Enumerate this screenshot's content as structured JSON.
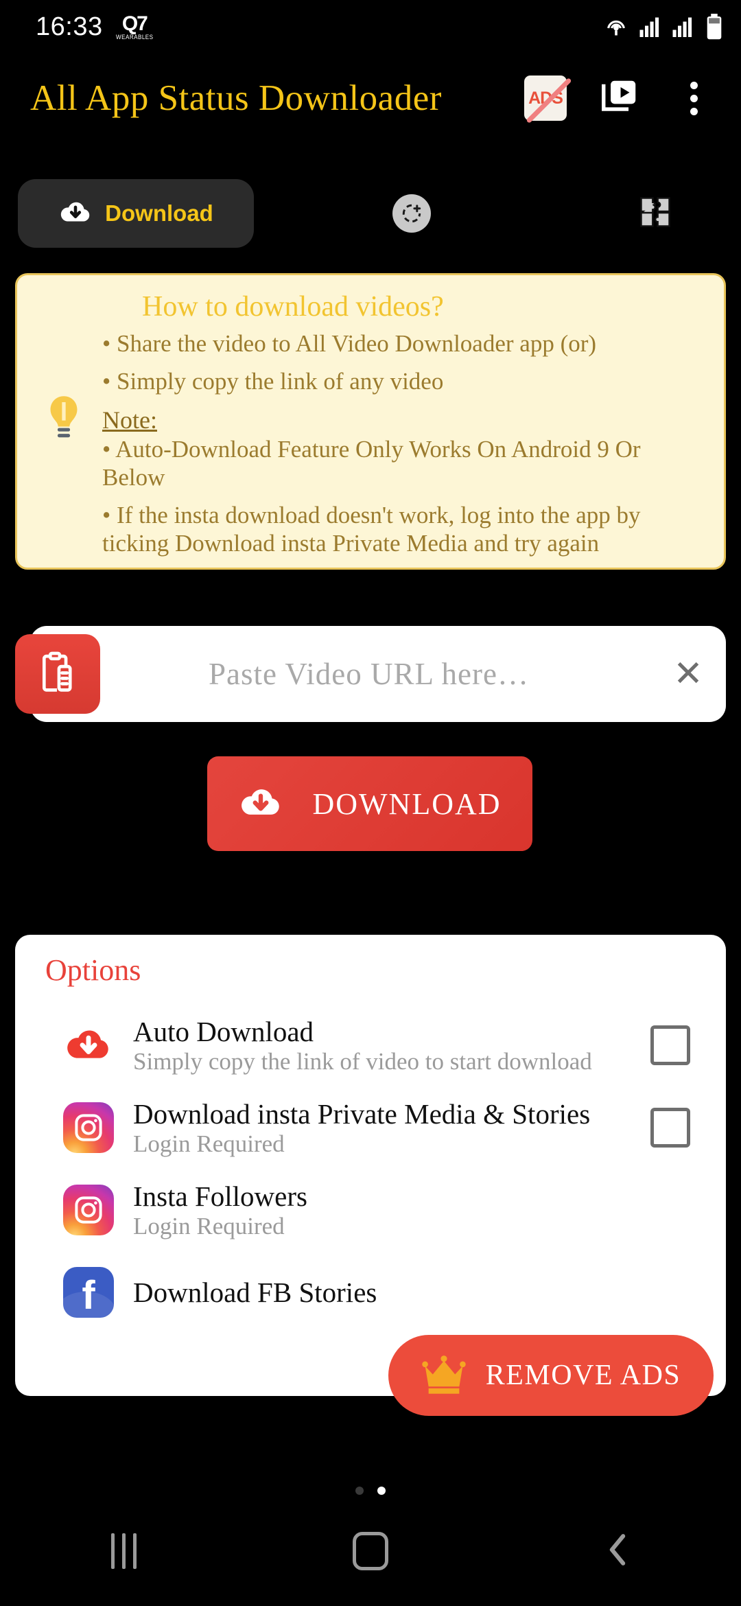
{
  "status_bar": {
    "time": "16:33",
    "app_badge_main": "Q7",
    "app_badge_sub": "WEARABLES",
    "icons": [
      "hotspot-icon",
      "signal-sim1-icon",
      "signal-sim2-icon",
      "battery-icon"
    ]
  },
  "app_bar": {
    "title": "All App Status Downloader",
    "title_color": "#F5C518",
    "no_ads_label": "ADS",
    "actions": [
      "no-ads-icon",
      "video-library-icon",
      "overflow-menu-icon"
    ]
  },
  "tabs": {
    "download_label": "Download",
    "download_icon": "cloud-download-icon",
    "status_icon": "add-status-icon",
    "puzzle_icon": "puzzle-icon",
    "active": "Download"
  },
  "info_card": {
    "icon": "lightbulb-icon",
    "title": "How to download videos?",
    "bullets": [
      "• Share the video to All Video Downloader app (or)",
      "• Simply copy the link of any video"
    ],
    "note_heading": "Note:",
    "notes": [
      "• Auto-Download Feature Only Works On Android 9 Or Below",
      "• If the insta download doesn't work, log into the app by ticking Download insta Private Media and try again"
    ],
    "bg_color": "#FDF6D6",
    "border_color": "#E8C45A",
    "title_color": "#F2C430",
    "text_color": "#9B7B2E"
  },
  "url_bar": {
    "paste_icon": "clipboard-paste-icon",
    "placeholder": "Paste Video URL here…",
    "value": "",
    "clear_label": "✕",
    "accent_color": "#E8453C"
  },
  "download_button": {
    "label": "DOWNLOAD",
    "icon": "cloud-download-icon",
    "color": "#E4453D"
  },
  "options": {
    "title": "Options",
    "title_color": "#E8423A",
    "rows": [
      {
        "icon": "cloud-download-red-icon",
        "title": "Auto Download",
        "subtitle": "Simply copy the link of video to start download",
        "checked": false
      },
      {
        "icon": "instagram-icon",
        "title": "Download insta Private Media & Stories",
        "subtitle": "Login Required",
        "checked": false
      },
      {
        "icon": "instagram-icon",
        "title": "Insta Followers",
        "subtitle": "Login Required",
        "checked": false
      },
      {
        "icon": "facebook-icon",
        "title": "Download FB Stories",
        "subtitle": "",
        "checked": false
      }
    ]
  },
  "remove_ads": {
    "label": "REMOVE ADS",
    "icon": "crown-icon",
    "color": "#EC4C3B"
  },
  "page_indicator": {
    "count": 2,
    "active_index": 1
  },
  "nav_bar": {
    "recents": "recents-icon",
    "home": "home-icon",
    "back": "back-icon"
  }
}
